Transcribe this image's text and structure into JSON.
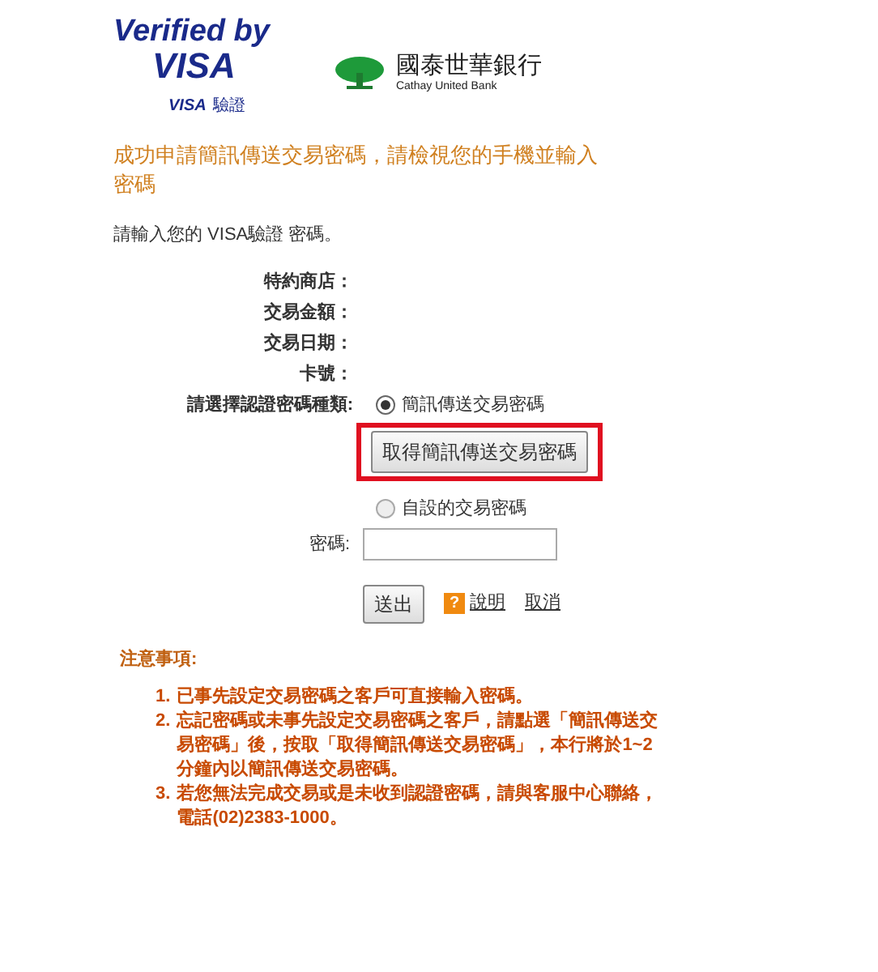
{
  "header": {
    "brand_top": "Verified by",
    "brand_main": "VISA",
    "brand_sub_a": "VISA",
    "brand_sub_b": "驗證",
    "bank_name": "國泰世華銀行",
    "bank_name_en": "Cathay United Bank"
  },
  "message": "成功申請簡訊傳送交易密碼，請檢視您的手機並輸入密碼",
  "instruction": "請輸入您的 VISA驗證 密碼。",
  "fields": [
    {
      "label": "特約商店："
    },
    {
      "label": "交易金額："
    },
    {
      "label": "交易日期："
    },
    {
      "label": "卡號："
    }
  ],
  "auth_type": {
    "label": "請選擇認證密碼種類:",
    "options": [
      {
        "label": "簡訊傳送交易密碼",
        "selected": true
      },
      {
        "label": "自設的交易密碼",
        "selected": false
      }
    ],
    "otp_button": "取得簡訊傳送交易密碼",
    "highlighted": true
  },
  "password": {
    "label": "密碼:"
  },
  "actions": {
    "submit": "送出",
    "help_icon": "?",
    "help": "說明",
    "cancel": "取消"
  },
  "notes": {
    "title": "注意事項:",
    "items": [
      {
        "number": "1.",
        "text": "已事先設定交易密碼之客戶可直接輸入密碼。"
      },
      {
        "number": "2.",
        "text": "忘記密碼或未事先設定交易密碼之客戶，請點選「簡訊傳送交易密碼」後，按取「取得簡訊傳送交易密碼」，本行將於1~2分鐘內以簡訊傳送交易密碼。"
      },
      {
        "number": "3.",
        "text": "若您無法完成交易或是未收到認證密碼，請與客服中心聯絡，電話(02)2383-1000。"
      }
    ]
  }
}
